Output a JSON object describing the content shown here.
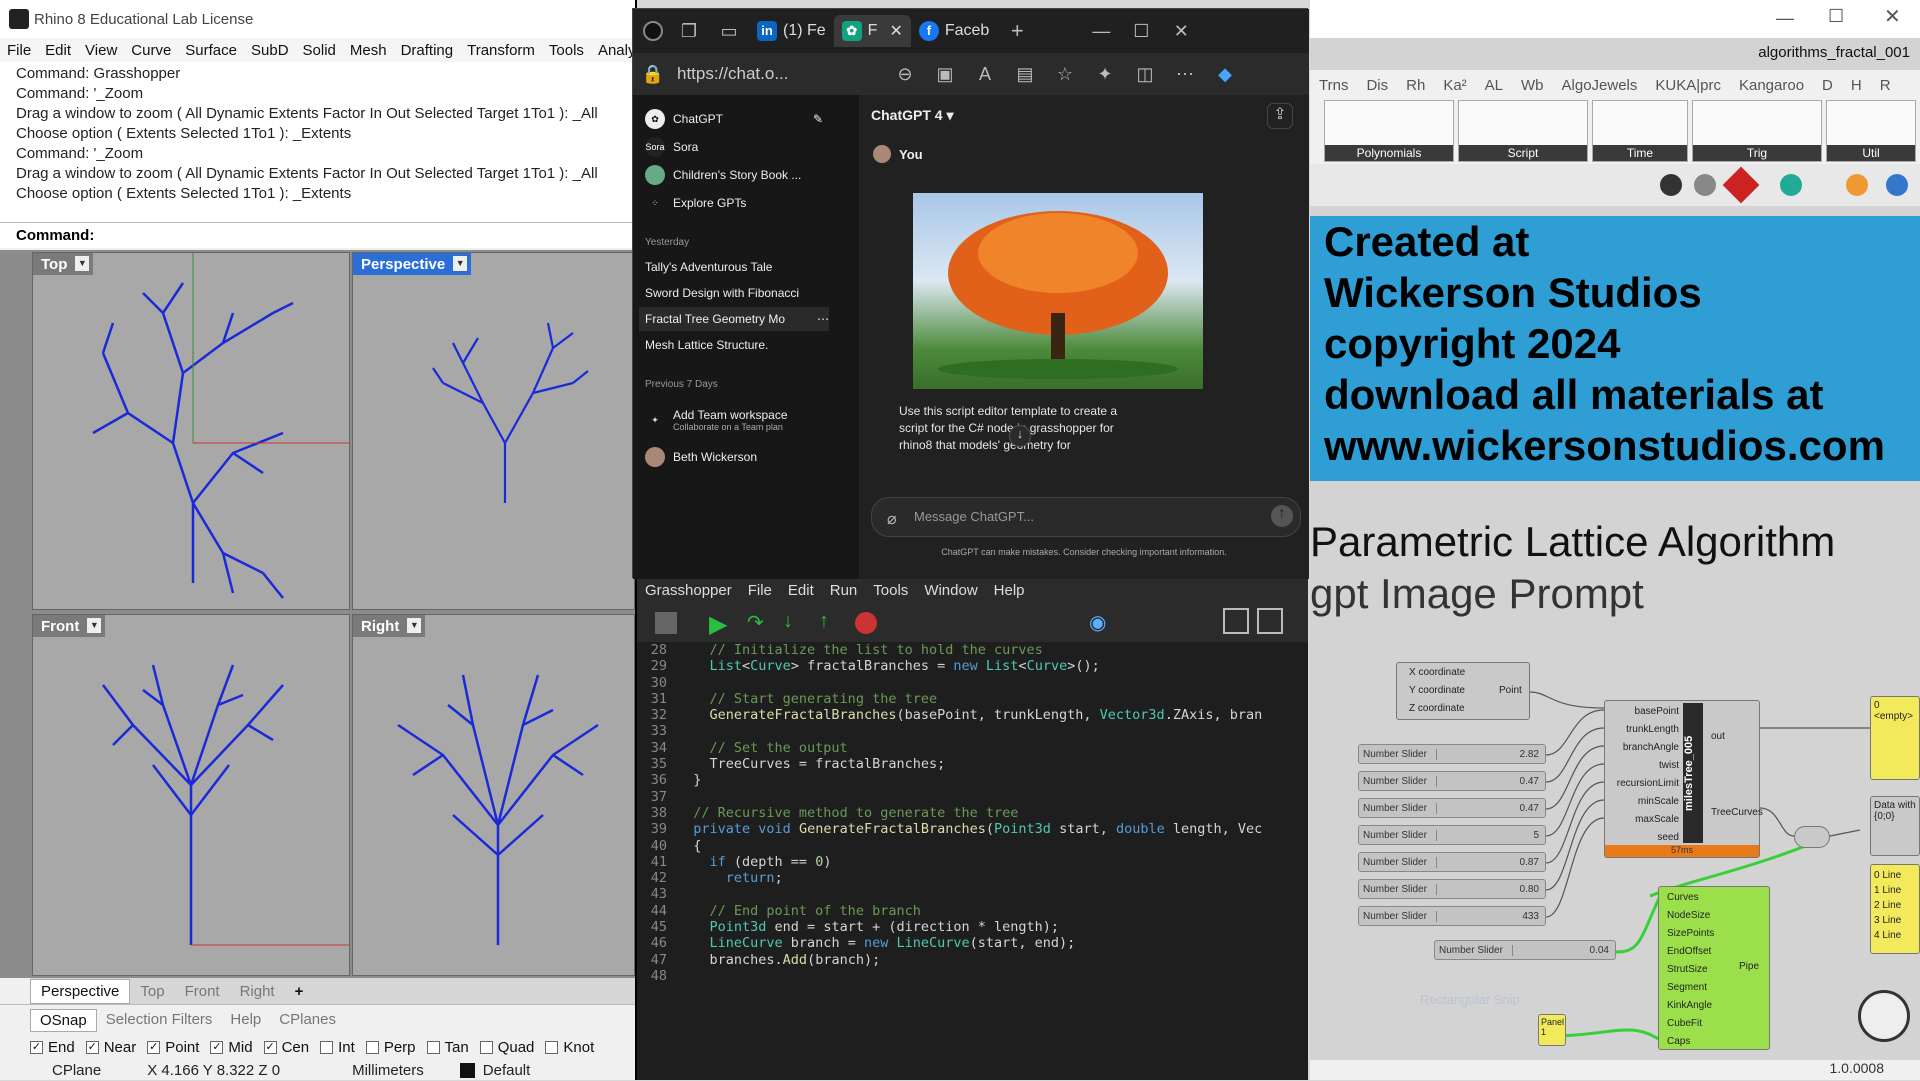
{
  "rhino": {
    "title": "Rhino 8 Educational Lab License",
    "menu": [
      "File",
      "Edit",
      "View",
      "Curve",
      "Surface",
      "SubD",
      "Solid",
      "Mesh",
      "Drafting",
      "Transform",
      "Tools",
      "Analy"
    ],
    "history": [
      "Command: Grasshopper",
      "Command: '_Zoom",
      "Drag a window to zoom ( All  Dynamic  Extents  Factor  In  Out  Selected  Target  1To1 ): _All",
      "Choose option ( Extents  Selected  1To1 ): _Extents",
      "Command: '_Zoom",
      "Drag a window to zoom ( All  Dynamic  Extents  Factor  In  Out  Selected  Target  1To1 ): _All",
      "Choose option ( Extents  Selected  1To1 ): _Extents"
    ],
    "command_label": "Command:",
    "viewports": {
      "top": "Top",
      "perspective": "Perspective",
      "front": "Front",
      "right": "Right"
    },
    "viewport_tabs": [
      "Perspective",
      "Top",
      "Front",
      "Right",
      "+"
    ],
    "osnap_tabs": [
      "OSnap",
      "Selection Filters",
      "Help",
      "CPlanes"
    ],
    "osnaps": [
      {
        "label": "End",
        "checked": true
      },
      {
        "label": "Near",
        "checked": true
      },
      {
        "label": "Point",
        "checked": true
      },
      {
        "label": "Mid",
        "checked": true
      },
      {
        "label": "Cen",
        "checked": true
      },
      {
        "label": "Int",
        "checked": false
      },
      {
        "label": "Perp",
        "checked": false
      },
      {
        "label": "Tan",
        "checked": false
      },
      {
        "label": "Quad",
        "checked": false
      },
      {
        "label": "Knot",
        "checked": false
      }
    ],
    "status": {
      "cplane": "CPlane",
      "coords": "X 4.166 Y 8.322 Z 0",
      "units": "Millimeters",
      "layer": "Default"
    }
  },
  "browser": {
    "tabs": [
      "(1) Fe",
      "F",
      "Faceb"
    ],
    "url": "https://chat.o...",
    "sidebar": {
      "app": "ChatGPT",
      "items": [
        "Sora",
        "Children's Story Book ...",
        "Explore GPTs"
      ],
      "yesterday_label": "Yesterday",
      "yesterday": [
        "Tally's Adventurous Tale",
        "Sword Design with Fibonacci",
        "Fractal Tree Geometry Mo",
        "Mesh Lattice Structure."
      ],
      "prev_label": "Previous 7 Days",
      "team_title": "Add Team workspace",
      "team_sub": "Collaborate on a Team plan",
      "user": "Beth Wickerson"
    },
    "model": "ChatGPT 4",
    "you_label": "You",
    "prompt_text": "Use this script editor template to create a script for the C# node in grasshopper for rhino8 that models' geometry for",
    "input_placeholder": "Message ChatGPT...",
    "disclaimer": "ChatGPT can make mistakes. Consider checking important information."
  },
  "editor": {
    "menu": [
      "Grasshopper",
      "File",
      "Edit",
      "Run",
      "Tools",
      "Window",
      "Help"
    ],
    "lines": [
      {
        "n": "28",
        "html": "    <span class='cm'>// Initialize the list to hold the curves</span>"
      },
      {
        "n": "29",
        "html": "    <span class='ty'>List</span>&lt;<span class='ty'>Curve</span>&gt; fractalBranches = <span class='kw'>new</span> <span class='ty'>List</span>&lt;<span class='ty'>Curve</span>&gt;();"
      },
      {
        "n": "30",
        "html": ""
      },
      {
        "n": "31",
        "html": "    <span class='cm'>// Start generating the tree</span>"
      },
      {
        "n": "32",
        "html": "    <span class='fn'>GenerateFractalBranches</span>(basePoint, trunkLength, <span class='ty'>Vector3d</span>.ZAxis, bran"
      },
      {
        "n": "33",
        "html": ""
      },
      {
        "n": "34",
        "html": "    <span class='cm'>// Set the output</span>"
      },
      {
        "n": "35",
        "html": "    TreeCurves = fractalBranches;"
      },
      {
        "n": "36",
        "html": "  }"
      },
      {
        "n": "37",
        "html": ""
      },
      {
        "n": "38",
        "html": "  <span class='cm'>// Recursive method to generate the tree</span>"
      },
      {
        "n": "39",
        "html": "  <span class='kw'>private void</span> <span class='fn'>GenerateFractalBranches</span>(<span class='ty'>Point3d</span> start, <span class='kw'>double</span> length, Vec"
      },
      {
        "n": "40",
        "html": "  {"
      },
      {
        "n": "41",
        "html": "    <span class='kw'>if</span> (depth == <span class='nu'>0</span>)"
      },
      {
        "n": "42",
        "html": "      <span class='kw'>return</span>;"
      },
      {
        "n": "43",
        "html": ""
      },
      {
        "n": "44",
        "html": "    <span class='cm'>// End point of the branch</span>"
      },
      {
        "n": "45",
        "html": "    <span class='ty'>Point3d</span> end = start + (direction * length);"
      },
      {
        "n": "46",
        "html": "    <span class='ty'>LineCurve</span> branch = <span class='kw'>new</span> <span class='ty'>LineCurve</span>(start, end);"
      },
      {
        "n": "47",
        "html": "    branches.<span class='fn'>Add</span>(branch);"
      },
      {
        "n": "48",
        "html": ""
      }
    ]
  },
  "grasshopper": {
    "doc_title": "algorithms_fractal_001",
    "tabs": [
      "Trns",
      "Dis",
      "Rh",
      "Ka²",
      "AL",
      "Wb",
      "AlgoJewels",
      "KUKA|prc",
      "Kangaroo",
      "D",
      "H",
      "R"
    ],
    "ribbon_groups": [
      "Polynomials",
      "Script",
      "Time",
      "Trig",
      "Util"
    ],
    "banner": [
      "Created at",
      "Wickerson Studios",
      "copyright 2024",
      "download all materials at",
      "www.wickersonstudios.com"
    ],
    "title1": "Parametric Lattice Algorithm",
    "title2": "gpt Image Prompt",
    "point_node": {
      "inputs": [
        "X coordinate",
        "Y coordinate",
        "Z coordinate"
      ],
      "label": "Point"
    },
    "sliders": [
      {
        "label": "Number Slider",
        "value": "2.82"
      },
      {
        "label": "Number Slider",
        "value": "0.47"
      },
      {
        "label": "Number Slider",
        "value": "0.47"
      },
      {
        "label": "Number Slider",
        "value": "5"
      },
      {
        "label": "Number Slider",
        "value": "0.87"
      },
      {
        "label": "Number Slider",
        "value": "0.80"
      },
      {
        "label": "Number Slider",
        "value": "433"
      }
    ],
    "slider_pipe": {
      "label": "Number Slider",
      "value": "0.04"
    },
    "script_node": {
      "name": "milesTree_005",
      "inputs": [
        "basePoint",
        "trunkLength",
        "branchAngle",
        "twist",
        "recursionLimit",
        "minScale",
        "maxScale",
        "seed"
      ],
      "outputs": [
        "out",
        "TreeCurves"
      ],
      "time": "57ms"
    },
    "pipe_node": {
      "inputs": [
        "Curves",
        "NodeSize",
        "SizePoints",
        "EndOffset",
        "StrutSize",
        "Segment",
        "KinkAngle",
        "CubeFit",
        "Caps"
      ],
      "label": "Pipe"
    },
    "panel": {
      "label": "Panel",
      "value": "1"
    },
    "empty_panel": "0 <empty>",
    "data_node": "Data with",
    "data_sub": "{0;0}",
    "list_panel": [
      "0 Line",
      "1 Line",
      "2 Line",
      "3 Line",
      "4 Line"
    ],
    "faded_label": "Rectangular Snip",
    "zoom": "1.0.0008"
  }
}
